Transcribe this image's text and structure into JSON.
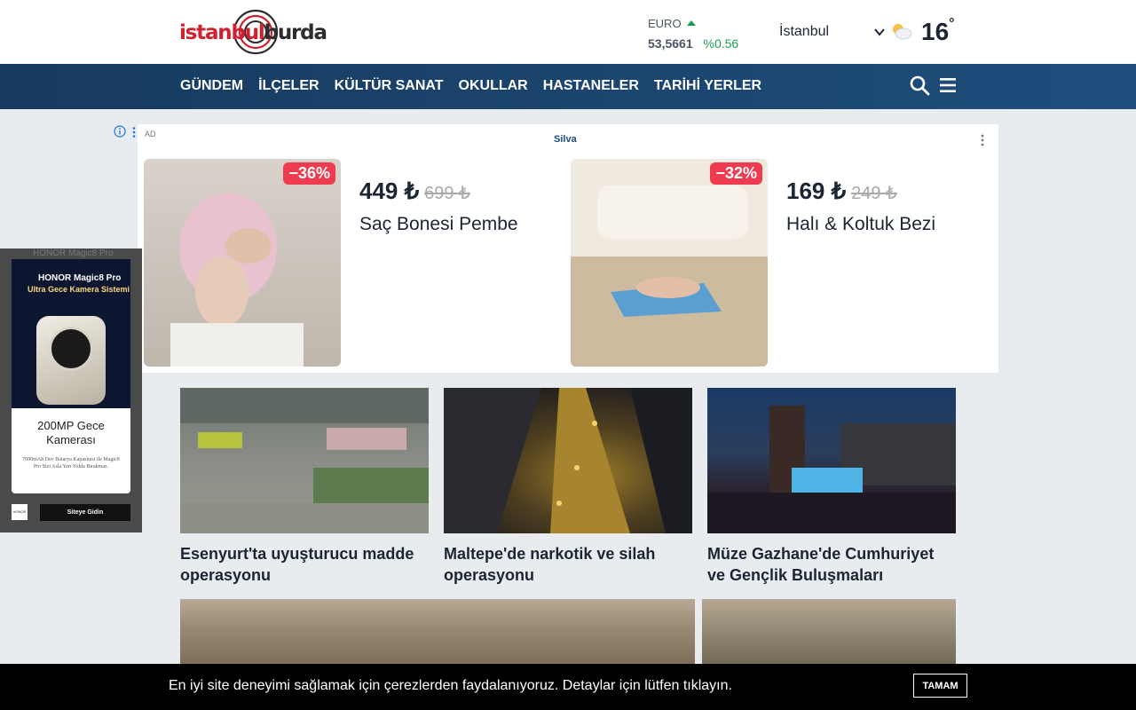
{
  "header": {
    "logo_part1": "istanbul",
    "logo_part2": "burda",
    "currency": {
      "label": "EURO",
      "value": "53,5661",
      "change": "%0.56",
      "direction": "up",
      "up_color": "#1f9d55"
    },
    "city": "İstanbul",
    "temperature": "16",
    "temperature_unit": "°",
    "weather_icon": "partly-cloudy-icon"
  },
  "nav": {
    "items": [
      {
        "label": "GÜNDEM"
      },
      {
        "label": "İLÇELER"
      },
      {
        "label": "KÜLTÜR SANAT"
      },
      {
        "label": "OKULLAR"
      },
      {
        "label": "HASTANELER"
      },
      {
        "label": "TARİHİ YERLER"
      }
    ],
    "icons": [
      "search-icon",
      "hamburger-menu-icon"
    ],
    "bg_color": "#1f4e7d"
  },
  "ad": {
    "tag": "AD",
    "brand": "Silva",
    "products": [
      {
        "discount": "−36%",
        "price": "449 ₺",
        "old_price": "699 ₺",
        "name": "Saç Bonesi Pembe"
      },
      {
        "discount": "−32%",
        "price": "169 ₺",
        "old_price": "249 ₺",
        "name": "Halı & Koltuk Bezi"
      }
    ],
    "discount_color": "#ef3b4f"
  },
  "side_ad": {
    "top_text": "HONOR Magic8 Pro",
    "brand": "HONOR Magic8 Pro",
    "subtitle": "Ultra Gece Kamera Sistemi",
    "title": "200MP Gece Kamerası",
    "description": "7000mAh Dev Batarya Kapasitesi ile Magic8 Pro Sizi Asla Yarı Yolda Bırakmaz.",
    "logo_text": "HONOR",
    "cta": "Siteye Gidin"
  },
  "news": [
    {
      "title": "Esenyurt'ta uyuşturucu madde operasyonu"
    },
    {
      "title": "Maltepe'de narkotik ve silah operasyonu"
    },
    {
      "title": "Müze Gazhane'de Cumhuriyet ve Gençlik Buluşmaları"
    }
  ],
  "cookie": {
    "text": "En iyi site deneyimi sağlamak için çerezlerden faydalanıyoruz. Detaylar için lütfen tıklayın.",
    "button": "TAMAM"
  }
}
